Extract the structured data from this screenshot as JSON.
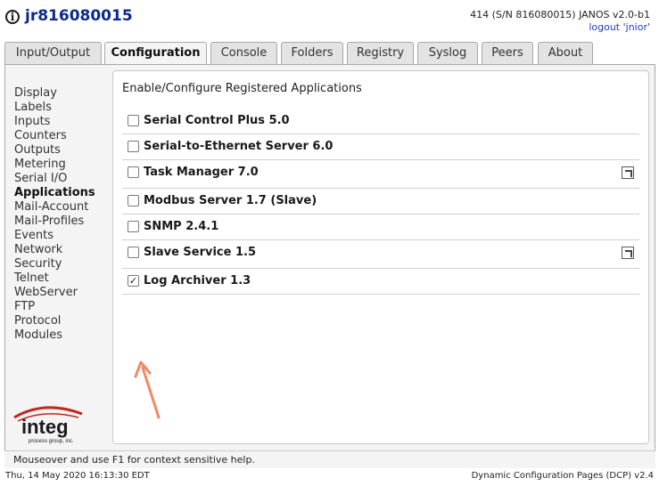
{
  "header": {
    "hostname": "jr816080015",
    "device_info": "414 (S/N 816080015) JANOS v2.0-b1",
    "logout_label": "logout 'jnior'"
  },
  "tabs": [
    {
      "label": "Input/Output",
      "active": false
    },
    {
      "label": "Configuration",
      "active": true
    },
    {
      "label": "Console",
      "active": false
    },
    {
      "label": "Folders",
      "active": false
    },
    {
      "label": "Registry",
      "active": false
    },
    {
      "label": "Syslog",
      "active": false
    },
    {
      "label": "Peers",
      "active": false
    },
    {
      "label": "About",
      "active": false
    }
  ],
  "sidebar": {
    "items": [
      {
        "label": "Display"
      },
      {
        "label": "Labels"
      },
      {
        "label": "Inputs"
      },
      {
        "label": "Counters"
      },
      {
        "label": "Outputs"
      },
      {
        "label": "Metering"
      },
      {
        "label": "Serial I/O"
      },
      {
        "label": "Applications",
        "active": true
      },
      {
        "label": "Mail-Account"
      },
      {
        "label": "Mail-Profiles"
      },
      {
        "label": "Events"
      },
      {
        "label": "Network"
      },
      {
        "label": "Security"
      },
      {
        "label": "Telnet"
      },
      {
        "label": "WebServer"
      },
      {
        "label": "FTP"
      },
      {
        "label": "Protocol"
      },
      {
        "label": "Modules"
      }
    ]
  },
  "logo": {
    "name": "integ",
    "tagline": "process group, inc.",
    "accent_color": "#c0271f"
  },
  "main": {
    "title": "Enable/Configure Registered Applications",
    "apps": [
      {
        "name": "Serial Control Plus 5.0",
        "checked": false,
        "has_config": false
      },
      {
        "name": "Serial-to-Ethernet Server 6.0",
        "checked": false,
        "has_config": false
      },
      {
        "name": "Task Manager 7.0",
        "checked": false,
        "has_config": true
      },
      {
        "name": "Modbus Server 1.7 (Slave)",
        "checked": false,
        "has_config": false
      },
      {
        "name": "SNMP 2.4.1",
        "checked": false,
        "has_config": false
      },
      {
        "name": "Slave Service 1.5",
        "checked": false,
        "has_config": true
      },
      {
        "name": "Log Archiver 1.3",
        "checked": true,
        "has_config": false
      }
    ]
  },
  "help_text": "Mouseover and use F1 for context sensitive help.",
  "footer": {
    "timestamp": "Thu, 14 May 2020 16:13:30 EDT",
    "version": "Dynamic Configuration Pages (DCP) v2.4"
  },
  "colors": {
    "hostname": "#0b2a8a",
    "link": "#1f3fbf",
    "annotation_arrow": "#f08a64"
  }
}
